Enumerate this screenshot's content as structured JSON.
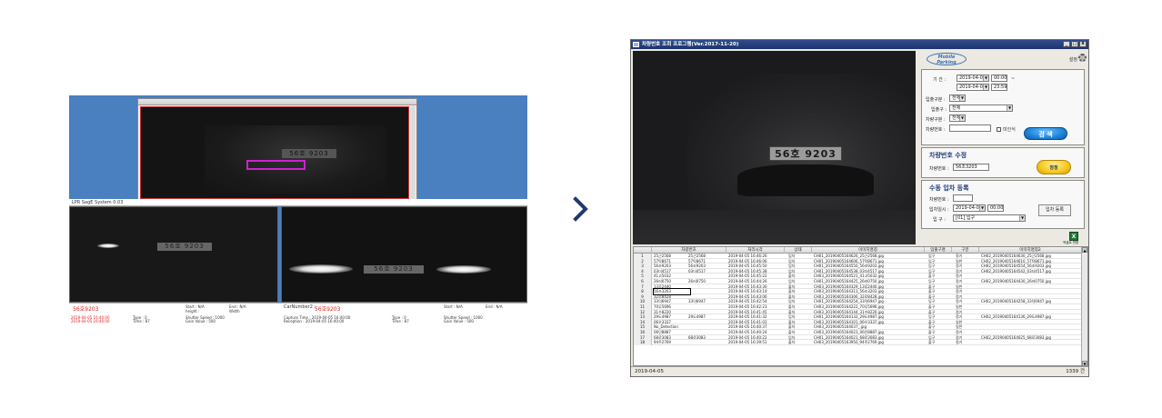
{
  "left_screenshot": {
    "system_bar": "LPR SagE System 0.03",
    "top_plate": "56호 9203",
    "cam1_plate": "56호 9203",
    "cam2_plate": "56호 9203",
    "cam2_label": "CarNumber2 :",
    "info_left": {
      "plate": "56호9203",
      "start": "Start : N/A",
      "end": "End : N/A",
      "height": "height :",
      "width": "Width",
      "type": "Type : 0",
      "time": "Time : 87",
      "shutter": "Shutter Speed : 1000",
      "gain": "Gain Value : 500",
      "line1": "2019-04-05 16:40:00",
      "line2": "2019-04-05 16:40:00"
    },
    "info_right": {
      "plate": "56호9203",
      "capture": "Capture Time : 2019-04-05 16:40:00",
      "reception": "Reception : 2019-04-05 16:40:00",
      "start": "Start : N/A",
      "end": "End : N/A",
      "type": "Type : 0",
      "time": "Time : 87",
      "shutter": "Shutter Speed : 1000",
      "gain": "Gain Value : 500"
    }
  },
  "arrow_icon": "chevron-right-icon",
  "app": {
    "title": "차량번호 조회 프로그램(Ver.2017-11-20)",
    "window_buttons": [
      "_",
      "□",
      "x"
    ],
    "main_plate": "56호 9203",
    "logo": [
      "Mobile",
      "Parking"
    ],
    "settings_label": "설정",
    "search_panel": {
      "period_label": "기  간 :",
      "date_from": "2019-04-05",
      "time_from": "00:00",
      "date_to": "2019-04-05",
      "time_to": "23:59",
      "tilde": "~",
      "inout_type_label": "입출구분 :",
      "inout_type_value": "전체",
      "gate_label": "입출구 :",
      "gate_value": "전체",
      "car_type_label": "차량구분 :",
      "car_type_value": "전체",
      "car_number_label": "차량번호 :",
      "car_number_value": "",
      "unrecognized_label": "미인식",
      "search_button": "검 색"
    },
    "modify_panel": {
      "title": "차량번호 수정",
      "car_number_label": "차량번호 :",
      "car_number_value": "56조3203",
      "modify_button": "정정"
    },
    "manual_panel": {
      "title": "수동 입차 등록",
      "car_number_label": "차량번호 :",
      "car_number_value": "",
      "entry_time_label": "입차일시 :",
      "entry_date": "2019-04-05",
      "entry_time": "00:00",
      "gate_label": "입 구 :",
      "gate_value": "[01] 입구",
      "register_button": "입차 등록"
    },
    "excel_button": "엑셀로 변환",
    "table": {
      "columns": [
        "",
        "차량번호",
        "",
        "처리시각",
        "상태",
        "이미지명칭",
        "입출구명",
        "구분",
        "이미지명칭2"
      ],
      "rows": [
        [
          "1",
          "25근2568",
          "25근2568",
          "2019-04-05 16:46:26",
          "입차",
          "CH01_20190405164626_25근2568.jpg",
          "입구",
          "정기",
          "CH02_20190405164630_25근2568.jpg"
        ],
        [
          "2",
          "57탁8671",
          "57탁8671",
          "2019-04-05 16:46:06",
          "입차",
          "CH01_20190405164606_57탁8671.jpg",
          "입구",
          "일반",
          "CH02_20190405164610_57탁8671.jpg"
        ],
        [
          "3",
          "56조9203",
          "56조9203",
          "2019-04-05 16:45:50",
          "입차",
          "CH01_20190405164550_56조9203.jpg",
          "입구",
          "정기",
          "CH02_20190405164554_56조9203.jpg"
        ],
        [
          "4",
          "03더4517",
          "03더4517",
          "2019-04-05 16:45:38",
          "입차",
          "CH01_20190405164538_03더4517.jpg",
          "입구",
          "정기",
          "CH02_20190405164542_03더4517.jpg"
        ],
        [
          "5",
          "41고5032",
          "",
          "2019-04-05 16:45:22",
          "출차",
          "CH03_20190405164521_41고5032.jpg",
          "출구",
          "정기",
          ""
        ],
        [
          "6",
          "26러0750",
          "26러0750",
          "2019-04-05 16:44:26",
          "입차",
          "CH01_20190405164425_26러0750.jpg",
          "입구",
          "정기",
          "CH02_20190405164430_26러0750.jpg"
        ],
        [
          "7",
          "13루2440",
          "",
          "2019-04-05 16:43:30",
          "출차",
          "CH03_20190405164329_13루2440.jpg",
          "출구",
          "일반",
          ""
        ],
        [
          "8",
          "56조3203",
          "",
          "2019-04-05 16:43:14",
          "출차",
          "CH03_20190405164313_56조3203.jpg",
          "출구",
          "정기",
          ""
        ],
        [
          "9",
          "32로8428",
          "",
          "2019-04-05 16:43:06",
          "출차",
          "CH03_20190405164306_32로8428.jpg",
          "출구",
          "정기",
          ""
        ],
        [
          "10",
          "33덕6947",
          "33덕6947",
          "2019-04-05 16:42:54",
          "입차",
          "CH01_20190405164254_33덕6947.jpg",
          "입구",
          "정기",
          "CH02_20190405164258_33덕6947.jpg"
        ],
        [
          "11",
          "70무5696",
          "",
          "2019-04-05 16:42:23",
          "출차",
          "CH03_20190405164222_70무5696.jpg",
          "출구",
          "일반",
          ""
        ],
        [
          "12",
          "31수8220",
          "",
          "2019-04-05 16:41:45",
          "출차",
          "CH03_20190405164144_31수8220.jpg",
          "출구",
          "정기",
          ""
        ],
        [
          "13",
          "29도4987",
          "29도4987",
          "2019-04-05 16:41:32",
          "입차",
          "CH01_20190405164132_29도4987.jpg",
          "입구",
          "정기",
          "CH02_20190405164136_29도4987.jpg"
        ],
        [
          "14",
          "06우3337",
          "",
          "2019-04-05 16:41:02",
          "출차",
          "CH03_20190405164101_06우3337.jpg",
          "출구",
          "일반",
          ""
        ],
        [
          "15",
          "No_Detection",
          "",
          "2019-04-05 16:40:37",
          "출차",
          "CH03_20190405164037_.jpg",
          "출구",
          "일반",
          ""
        ],
        [
          "16",
          "06던8887",
          "",
          "2019-04-05 16:40:24",
          "출차",
          "CH03_20190405164023_06던8887.jpg",
          "출구",
          "정기",
          ""
        ],
        [
          "17",
          "68로3083",
          "68로3083",
          "2019-04-05 16:40:22",
          "입차",
          "CH01_20190405164021_68로3083.jpg",
          "입구",
          "정기",
          "CH02_20190405164025_68로3083.jpg"
        ],
        [
          "18",
          "94주2769",
          "",
          "2019-04-05 16:39:51",
          "출차",
          "CH03_20190405163950_94주2769.jpg",
          "출구",
          "정기",
          ""
        ]
      ]
    },
    "status_bar": {
      "date": "2019-04-05",
      "count": "1339 건"
    }
  }
}
